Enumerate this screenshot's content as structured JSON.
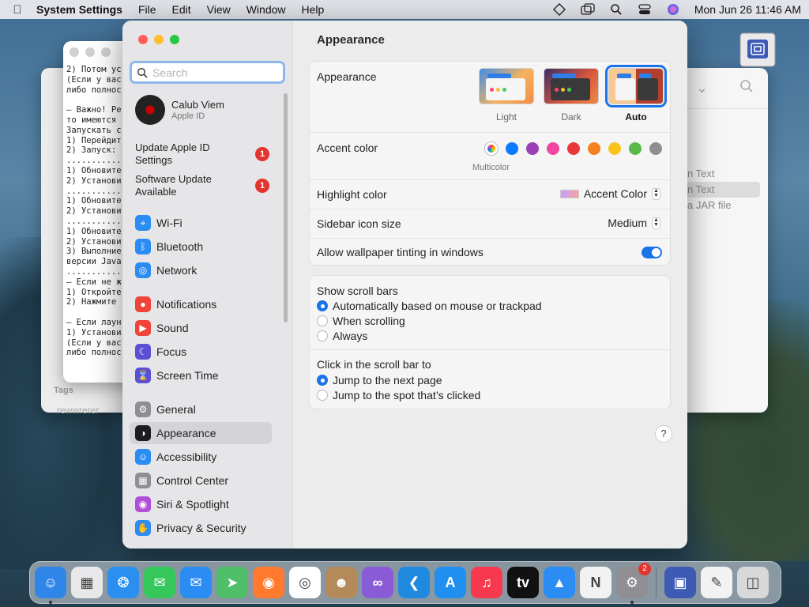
{
  "menubar": {
    "app_name": "System Settings",
    "menus": [
      "File",
      "Edit",
      "View",
      "Window",
      "Help"
    ],
    "clock": "Mon Jun 26  11:46 AM"
  },
  "bg_text_window": {
    "lines": [
      "2) Потом ус",
      "(Если у вас",
      "либо полнос",
      "",
      "– Важно! Ре",
      "то имеются ",
      "Запускать с",
      "1) Перейдит",
      "2) Запуск: ",
      "...........",
      "1) Обновите",
      "2) Установи",
      "...........",
      "1) Обновите",
      "2) Установи",
      "...........",
      "1) Обновите",
      "2) Установи",
      "3) Выполние",
      "версии Java",
      "...........",
      "– Если не ж",
      "1) Откройте",
      "2) Нажмите ",
      "",
      "– Если лаун",
      "1) Установи",
      "(Если у вас",
      "либо полнос"
    ]
  },
  "bg_finder_window": {
    "tags_label": "Tags",
    "tag_item": "rewwrerer"
  },
  "bg_jar_window": {
    "rows": [
      "n Text",
      "n Text",
      "a JAR file"
    ]
  },
  "sidebar": {
    "search_placeholder": "Search",
    "profile": {
      "name": "Calub Viem",
      "subtitle": "Apple ID"
    },
    "notices": [
      {
        "label": "Update Apple ID Settings",
        "badge": "1"
      },
      {
        "label": "Software Update Available",
        "badge": "1"
      }
    ],
    "items": [
      {
        "label": "Wi-Fi",
        "icon": "wifi-icon",
        "color": "#2b8cf3"
      },
      {
        "label": "Bluetooth",
        "icon": "bluetooth-icon",
        "color": "#2b8cf3"
      },
      {
        "label": "Network",
        "icon": "globe-icon",
        "color": "#2b8cf3"
      },
      {
        "label": "Notifications",
        "icon": "bell-icon",
        "color": "#f0443a"
      },
      {
        "label": "Sound",
        "icon": "speaker-icon",
        "color": "#f0443a"
      },
      {
        "label": "Focus",
        "icon": "moon-icon",
        "color": "#5b4fd6"
      },
      {
        "label": "Screen Time",
        "icon": "hourglass-icon",
        "color": "#5b4fd6"
      },
      {
        "label": "General",
        "icon": "gear-icon",
        "color": "#8e8e93"
      },
      {
        "label": "Appearance",
        "icon": "appearance-icon",
        "color": "#1d1d1f",
        "active": true
      },
      {
        "label": "Accessibility",
        "icon": "accessibility-icon",
        "color": "#2b8cf3"
      },
      {
        "label": "Control Center",
        "icon": "control-center-icon",
        "color": "#8e8e93"
      },
      {
        "label": "Siri & Spotlight",
        "icon": "siri-icon",
        "color": "#b04fd8"
      },
      {
        "label": "Privacy & Security",
        "icon": "hand-icon",
        "color": "#2b8cf3"
      }
    ]
  },
  "content": {
    "title": "Appearance",
    "appearance": {
      "label": "Appearance",
      "options": [
        "Light",
        "Dark",
        "Auto"
      ],
      "selected": "Auto"
    },
    "accent": {
      "label": "Accent color",
      "colors": [
        "#0a7aff",
        "#9a3fb5",
        "#f2479e",
        "#e8383a",
        "#f5811f",
        "#fbc21a",
        "#5ab946",
        "#8e8e93"
      ],
      "multicolor_caption": "Multicolor"
    },
    "highlight": {
      "label": "Highlight color",
      "value": "Accent Color"
    },
    "sidebar_icon_size": {
      "label": "Sidebar icon size",
      "value": "Medium"
    },
    "wallpaper_tinting": {
      "label": "Allow wallpaper tinting in windows",
      "on": true
    },
    "scroll_bars": {
      "label": "Show scroll bars",
      "options": [
        "Automatically based on mouse or trackpad",
        "When scrolling",
        "Always"
      ],
      "selected": 0
    },
    "click_scroll": {
      "label": "Click in the scroll bar to",
      "options": [
        "Jump to the next page",
        "Jump to the spot that’s clicked"
      ],
      "selected": 0
    },
    "help": "?"
  },
  "dock": {
    "apps": [
      {
        "name": "finder-icon",
        "color": "#2f86e8",
        "running": true
      },
      {
        "name": "launchpad-icon",
        "color": "#e8e8ea"
      },
      {
        "name": "safari-icon",
        "color": "#2b8ff0"
      },
      {
        "name": "messages-icon",
        "color": "#34c759"
      },
      {
        "name": "mail-icon",
        "color": "#2b8cf3"
      },
      {
        "name": "maps-icon",
        "color": "#4fbf6a"
      },
      {
        "name": "firefox-icon",
        "color": "#ff7a2e"
      },
      {
        "name": "chrome-icon",
        "color": "#ffffff"
      },
      {
        "name": "contacts-icon",
        "color": "#b58a5a"
      },
      {
        "name": "visual-studio-icon",
        "color": "#8a5bd6"
      },
      {
        "name": "vscode-icon",
        "color": "#1f8ae0"
      },
      {
        "name": "app-store-icon",
        "color": "#1f8ff0"
      },
      {
        "name": "music-icon",
        "color": "#f7384e"
      },
      {
        "name": "apple-tv-icon",
        "color": "#111111"
      },
      {
        "name": "keynote-icon",
        "color": "#2b8cf3"
      },
      {
        "name": "news-icon",
        "color": "#f2f2f2"
      },
      {
        "name": "system-settings-icon",
        "color": "#8e8e93",
        "badge": "2",
        "running": true
      }
    ],
    "right": [
      {
        "name": "disk-image-icon",
        "color": "#3d5bb5"
      },
      {
        "name": "textedit-icon",
        "color": "#f2f2f2"
      },
      {
        "name": "trash-icon",
        "color": "#d8d8d8"
      }
    ]
  }
}
